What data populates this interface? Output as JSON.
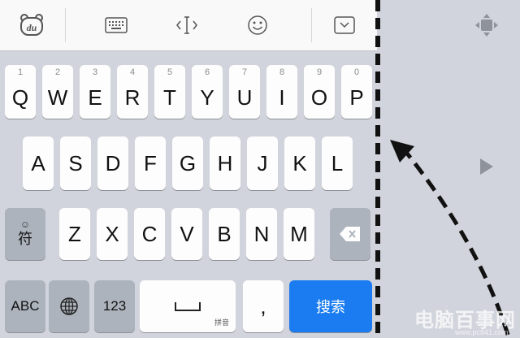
{
  "toolbar": {
    "logo_text": "du"
  },
  "rows": {
    "row1": [
      {
        "num": "1",
        "letter": "Q"
      },
      {
        "num": "2",
        "letter": "W"
      },
      {
        "num": "3",
        "letter": "E"
      },
      {
        "num": "4",
        "letter": "R"
      },
      {
        "num": "5",
        "letter": "T"
      },
      {
        "num": "6",
        "letter": "Y"
      },
      {
        "num": "7",
        "letter": "U"
      },
      {
        "num": "8",
        "letter": "I"
      },
      {
        "num": "9",
        "letter": "O"
      },
      {
        "num": "0",
        "letter": "P"
      }
    ],
    "row2": [
      "A",
      "S",
      "D",
      "F",
      "G",
      "H",
      "J",
      "K",
      "L"
    ],
    "row3": [
      "Z",
      "X",
      "C",
      "V",
      "B",
      "N",
      "M"
    ]
  },
  "keys": {
    "symbol_top": "☺",
    "symbol_label": "符",
    "abc_label": "ABC",
    "num_label": "123",
    "space_hint": "拼音",
    "comma_label": ",",
    "search_label": "搜索"
  },
  "watermark": {
    "main": "电脑百事网",
    "sub": "www.pc841.com"
  }
}
